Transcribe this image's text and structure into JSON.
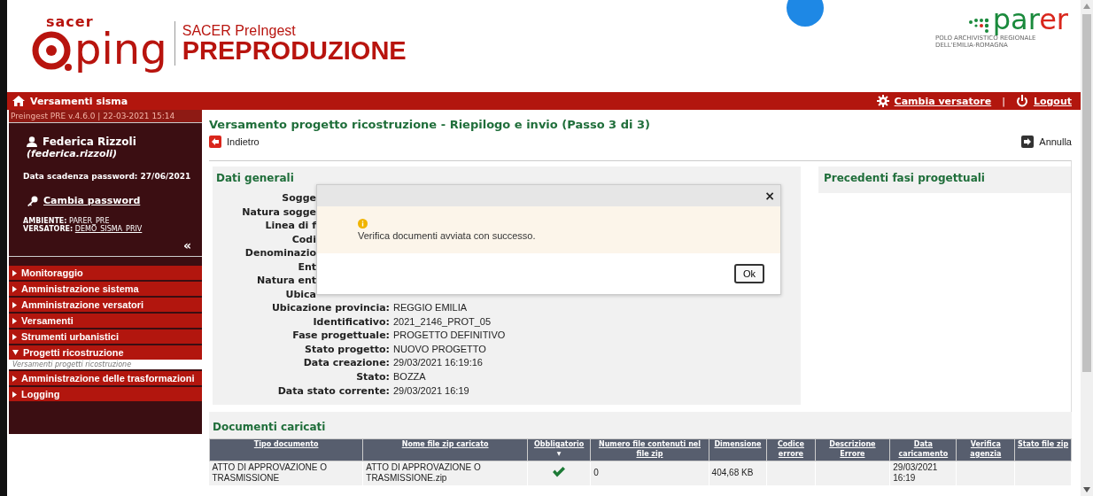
{
  "header": {
    "logo_top": "sacer",
    "logo_main": "ping",
    "app_subtitle": "SACER PreIngest",
    "app_title": "PREPRODUZIONE",
    "partner_logo": [
      {
        "text": "par",
        "color": "#1a8a3c"
      },
      {
        "text": "er",
        "color": "#d9261c"
      }
    ],
    "partner_tagline": "POLO ARCHIVISTICO REGIONALE DELL'EMILIA-ROMAGNA"
  },
  "topbar": {
    "home_label": "Versamenti sisma",
    "actions": [
      {
        "kind": "gear",
        "label": "Cambia versatore"
      },
      {
        "kind": "power",
        "label": "Logout"
      }
    ],
    "separator": "|"
  },
  "sidebar": {
    "version": "Preingest PRE v.4.6.0 | 22-03-2021 15:14",
    "user_name": "Federica Rizzoli",
    "user_login": "(federica.rizzoli)",
    "password_expiry_label": "Data scadenza password:",
    "password_expiry": "27/06/2021",
    "change_password": "Cambia password",
    "environment_label": "AMBIENTE:",
    "environment": "PARER_PRE",
    "depositor_label": "VERSATORE:",
    "depositor": "DEMO_SISMA_PRIV",
    "collapse": "«",
    "items": [
      {
        "label": "Monitoraggio",
        "expanded": false
      },
      {
        "label": "Amministrazione sistema",
        "expanded": false
      },
      {
        "label": "Amministrazione versatori",
        "expanded": false
      },
      {
        "label": "Versamenti",
        "expanded": false
      },
      {
        "label": "Strumenti urbanistici",
        "expanded": false
      },
      {
        "label": "Progetti ricostruzione",
        "expanded": true,
        "children": [
          {
            "label": "Versamenti progetti ricostruzione"
          }
        ]
      },
      {
        "label": "Amministrazione delle trasformazioni",
        "expanded": false
      },
      {
        "label": "Logging",
        "expanded": false
      }
    ]
  },
  "page": {
    "title": "Versamento progetto ricostruzione - Riepilogo e invio (Passo 3 di 3)",
    "back": "Indietro",
    "cancel": "Annulla"
  },
  "general": {
    "title": "Dati generali",
    "covered_labels": [
      "Sogge",
      "Natura sogge",
      "Linea di f",
      "Codi",
      "Denominazio",
      "Ent",
      "Natura ent",
      "Ubica"
    ],
    "fields": [
      {
        "label": "Ubicazione provincia:",
        "value": "REGGIO EMILIA"
      },
      {
        "label": "Identificativo:",
        "value": "2021_2146_PROT_05"
      },
      {
        "label": "Fase progettuale:",
        "value": "PROGETTO DEFINITIVO"
      },
      {
        "label": "Stato progetto:",
        "value": "NUOVO PROGETTO"
      },
      {
        "label": "Data creazione:",
        "value": "29/03/2021 16:19:16"
      },
      {
        "label": "Stato:",
        "value": "BOZZA"
      },
      {
        "label": "Data stato corrente:",
        "value": "29/03/2021 16:19"
      }
    ]
  },
  "dialog": {
    "close": "×",
    "message": "Verifica documenti avviata con successo.",
    "ok": "Ok"
  },
  "previous_phases": {
    "title": "Precedenti fasi progettuali"
  },
  "documents": {
    "title": "Documenti caricati",
    "columns": [
      {
        "label": "Tipo documento",
        "sorted": false
      },
      {
        "label": "Nome file zip caricato",
        "sorted": false
      },
      {
        "label": "Obbligatorio",
        "sorted": true
      },
      {
        "label": "Numero file contenuti nel file zip",
        "sorted": false
      },
      {
        "label": "Dimensione",
        "sorted": false
      },
      {
        "label": "Codice errore",
        "sorted": false
      },
      {
        "label": "Descrizione Errore",
        "sorted": false
      },
      {
        "label": "Data caricamento",
        "sorted": false
      },
      {
        "label": "Verifica agenzia",
        "sorted": false
      },
      {
        "label": "Stato file zip",
        "sorted": false
      }
    ],
    "sort_mark": "▼",
    "rows": [
      {
        "tipo": "ATTO DI APPROVAZIONE O TRASMISSIONE",
        "nome_file": "ATTO DI APPROVAZIONE O TRASMISSIONE.zip",
        "obbligatorio": true,
        "numero_file": "0",
        "dimensione": "404,68 KB",
        "data_caricamento": "29/03/2021 16:19"
      }
    ]
  }
}
